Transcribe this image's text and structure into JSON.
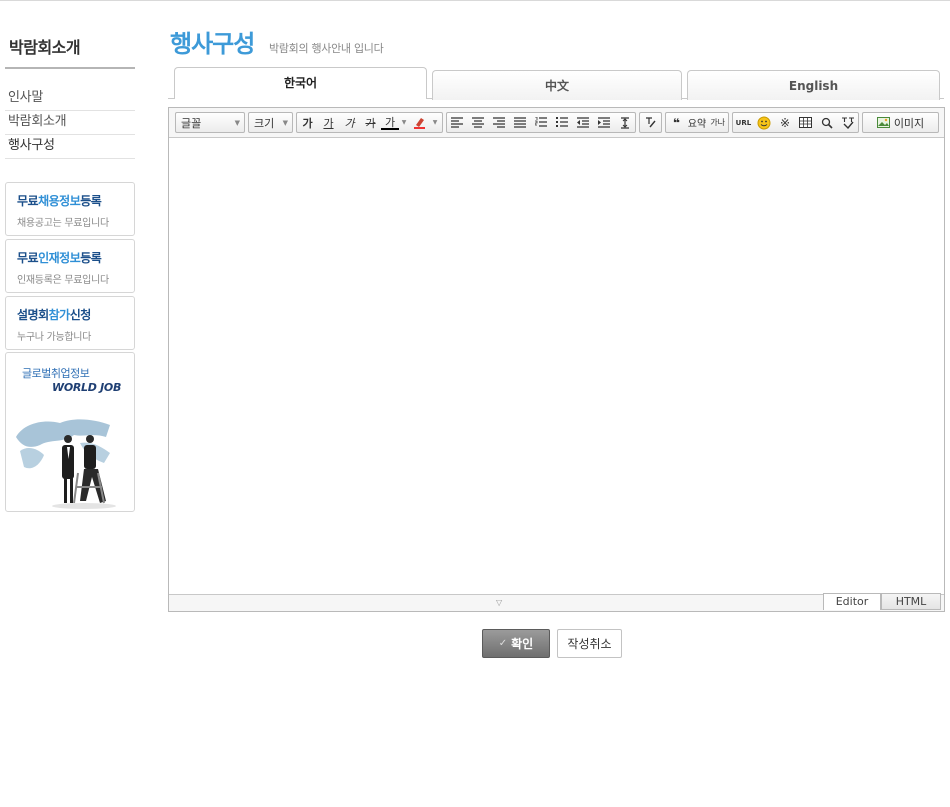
{
  "sidebar": {
    "title": "박람회소개",
    "menu": [
      {
        "label": "인사말"
      },
      {
        "label": "박람회소개"
      },
      {
        "label": "행사구성"
      }
    ],
    "promos": [
      {
        "title_dark1": "무료",
        "title_light": "채용정보",
        "title_dark2": "등록",
        "subtitle": "채용공고는 무료입니다"
      },
      {
        "title_dark1": "무료",
        "title_light": "인재정보",
        "title_dark2": "등록",
        "subtitle": "인재등록은 무료입니다"
      },
      {
        "title_dark1": "설명회",
        "title_light": "참가",
        "title_dark2": "신청",
        "subtitle": "누구나 가능합니다"
      }
    ],
    "worldjob": {
      "label": "글로벌취업정보",
      "logo": "WORLD JOB"
    }
  },
  "main": {
    "title": "행사구성",
    "subtitle": "박람회의 행사안내 입니다",
    "tabs": [
      {
        "label": "한국어",
        "active": true
      },
      {
        "label": "中文",
        "active": false
      },
      {
        "label": "English",
        "active": false
      }
    ]
  },
  "editor": {
    "toolbar": {
      "font_select": "글꼴",
      "size_select": "크기",
      "bold_glyph": "가",
      "underline_glyph": "가",
      "italic_glyph": "가",
      "strike_glyph": "가",
      "color_glyph": "가",
      "quote_glyph": "❝",
      "summary_label": "요약",
      "sup_label": "가나",
      "url_label": "URL",
      "image_label": "이미지"
    },
    "modes": {
      "editor": "Editor",
      "html": "HTML"
    }
  },
  "actions": {
    "confirm": "확인",
    "cancel": "작성취소"
  }
}
